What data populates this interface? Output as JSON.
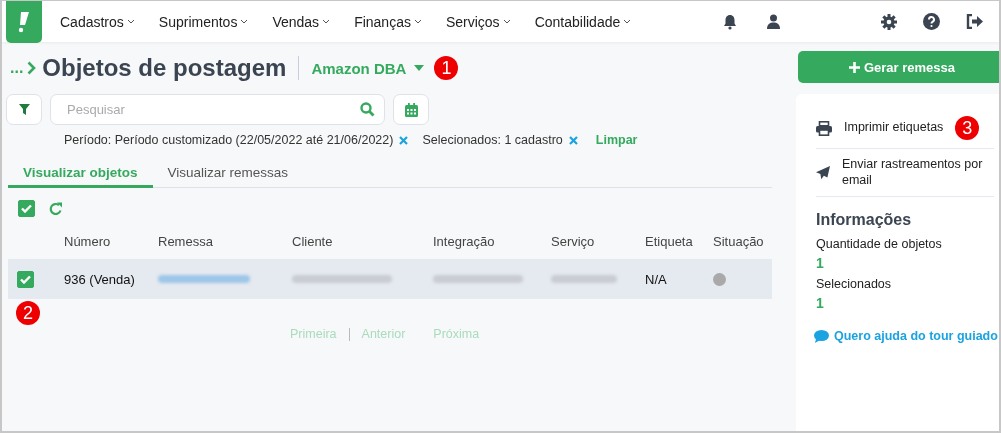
{
  "nav": {
    "menus": [
      {
        "label": "Cadastros"
      },
      {
        "label": "Suprimentos"
      },
      {
        "label": "Vendas"
      },
      {
        "label": "Finanças"
      },
      {
        "label": "Serviços"
      },
      {
        "label": "Contabilidade"
      }
    ]
  },
  "header": {
    "breadcrumb": "...",
    "title": "Objetos de postagem",
    "store": "Amazon DBA",
    "callout": "1"
  },
  "search": {
    "placeholder": "Pesquisar"
  },
  "filters": [
    {
      "text": "Período: Período customizado (22/05/2022 até 21/06/2022)"
    },
    {
      "text": "Selecionados: 1 cadastro"
    }
  ],
  "clear_link": "Limpar",
  "tabs": [
    {
      "label": "Visualizar objetos",
      "selected": true
    },
    {
      "label": "Visualizar remessas",
      "selected": false
    }
  ],
  "table": {
    "select_all": {
      "checked": true
    },
    "columns": [
      "Número",
      "Remessa",
      "Cliente",
      "Integração",
      "Serviço",
      "Etiqueta",
      "Situação"
    ],
    "rows": [
      {
        "checked": true,
        "selected": true,
        "numero": "936 (Venda)",
        "etiqueta": "N/A",
        "color": "#a9a9a9"
      }
    ]
  },
  "row_callout": "2",
  "pagination": [
    "Primeira",
    "Anterior",
    "Próxima"
  ],
  "sidebar": {
    "button": "Gerar remessa",
    "actions": [
      {
        "kind": "print",
        "label": "Imprimir etiquetas",
        "callout": "3"
      },
      {
        "kind": "send",
        "label": "Enviar rastreamentos por email"
      }
    ],
    "info_title": "Informações",
    "info": [
      {
        "label": "Quantidade de objetos",
        "value": "1"
      },
      {
        "label": "Selecionados",
        "value": "1"
      }
    ],
    "help_link": "Quero ajuda do tour guiado"
  }
}
